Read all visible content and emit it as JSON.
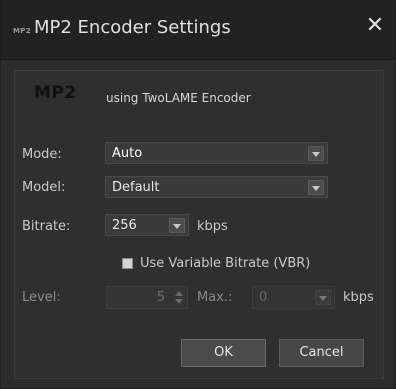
{
  "window": {
    "logo_text": "MP2",
    "title": "MP2 Encoder Settings",
    "close_glyph": "✕"
  },
  "header": {
    "logo": "MP2",
    "subtitle": "using TwoLAME Encoder"
  },
  "fields": {
    "mode": {
      "label": "Mode:",
      "value": "Auto"
    },
    "model": {
      "label": "Model:",
      "value": "Default"
    },
    "bitrate": {
      "label": "Bitrate:",
      "value": "256",
      "unit": "kbps"
    },
    "vbr": {
      "label": "Use Variable Bitrate (VBR)",
      "checked": false
    },
    "level": {
      "label": "Level:",
      "value": "5"
    },
    "max": {
      "label": "Max.:",
      "value": "0",
      "unit": "kbps"
    }
  },
  "buttons": {
    "ok": "OK",
    "cancel": "Cancel"
  }
}
